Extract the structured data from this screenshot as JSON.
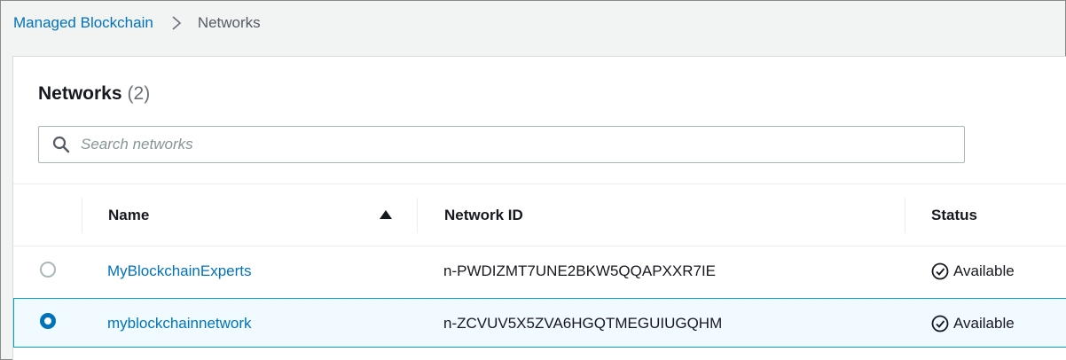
{
  "breadcrumb": {
    "parent": "Managed Blockchain",
    "current": "Networks"
  },
  "panel": {
    "title": "Networks",
    "count": "(2)"
  },
  "search": {
    "placeholder": "Search networks",
    "value": ""
  },
  "table": {
    "columns": [
      "Name",
      "Network ID",
      "Status"
    ],
    "sort": {
      "column": "Name",
      "direction": "ascending"
    },
    "rows": [
      {
        "name": "MyBlockchainExperts",
        "network_id": "n-PWDIZMT7UNE2BKW5QQAPXXR7IE",
        "status": "Available",
        "selected": false
      },
      {
        "name": "myblockchainnetwork",
        "network_id": "n-ZCVUV5X5ZVA6HGQTMEGUIUGQHM",
        "status": "Available",
        "selected": true
      }
    ]
  },
  "icons": {
    "breadcrumb_separator": "chevron-right-icon",
    "search": "search-icon",
    "sort": "sort-ascending-icon",
    "status": "check-circle-icon"
  },
  "colors": {
    "link": "#0073bb",
    "selected_row_bg": "#f1faff",
    "selected_row_border": "#00a1c9",
    "radio_selected": "#0073bb"
  }
}
